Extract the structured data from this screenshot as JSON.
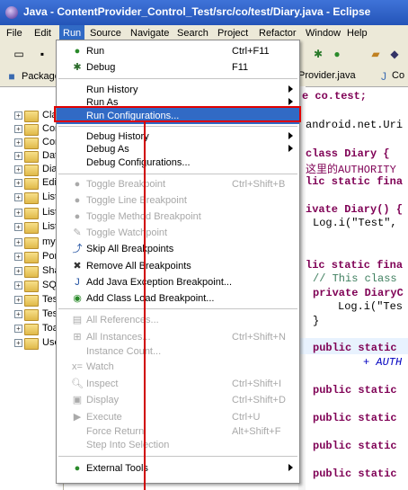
{
  "window": {
    "title": "Java - ContentProvider_Control_Test/src/co/test/Diary.java - Eclipse"
  },
  "menubar": {
    "items": [
      "File",
      "Edit",
      "Run",
      "Source",
      "Navigate",
      "Search",
      "Project",
      "Refactor",
      "Window",
      "Help"
    ]
  },
  "package_explorer": {
    "tab_label": "Package",
    "items": [
      "Cla",
      "Cor",
      "Cor",
      "Dat",
      "Dia",
      "Edi",
      "List",
      "List",
      "List",
      "myl",
      "Por",
      "Sha",
      "SQI",
      "Tes",
      "Tes",
      "Toa",
      "Use"
    ]
  },
  "editor": {
    "tabs": [
      "Provider.java",
      "Co"
    ],
    "lines": [
      "e co.test;",
      "android.net.Uri",
      "class Diary {",
      "这里的AUTHORITY",
      "lic static fina",
      "ivate Diary() {",
      "Log.i(\"Test\",",
      "lic static fina",
      "// This class",
      "private DiaryC",
      "Log.i(\"Tes",
      "}",
      "public static",
      "+ AUTH",
      "public static",
      "public static",
      "public static",
      "public static"
    ]
  },
  "run_menu": {
    "run": {
      "label": "Run",
      "shortcut": "Ctrl+F11"
    },
    "debug": {
      "label": "Debug",
      "shortcut": "F11"
    },
    "run_history": "Run History",
    "run_as": "Run As",
    "run_configurations": "Run Configurations...",
    "debug_history": "Debug History",
    "debug_as": "Debug As",
    "debug_configurations": "Debug Configurations...",
    "toggle_breakpoint": {
      "label": "Toggle Breakpoint",
      "shortcut": "Ctrl+Shift+B"
    },
    "toggle_line_breakpoint": "Toggle Line Breakpoint",
    "toggle_method_breakpoint": "Toggle Method Breakpoint",
    "toggle_watchpoint": "Toggle Watchpoint",
    "skip_all_breakpoints": "Skip All Breakpoints",
    "remove_all_breakpoints": "Remove All Breakpoints",
    "add_java_exception_breakpoint": "Add Java Exception Breakpoint...",
    "add_class_load_breakpoint": "Add Class Load Breakpoint...",
    "all_references": "All References...",
    "all_instances": {
      "label": "All Instances...",
      "shortcut": "Ctrl+Shift+N"
    },
    "instance_count": "Instance Count...",
    "watch": "Watch",
    "inspect": {
      "label": "Inspect",
      "shortcut": "Ctrl+Shift+I"
    },
    "display": {
      "label": "Display",
      "shortcut": "Ctrl+Shift+D"
    },
    "execute": {
      "label": "Execute",
      "shortcut": "Ctrl+U"
    },
    "force_return": {
      "label": "Force Return",
      "shortcut": "Alt+Shift+F"
    },
    "step_into_selection": "Step Into Selection",
    "external_tools": "External Tools"
  },
  "colors": {
    "selection": "#316ac5",
    "annotation": "#e00000"
  }
}
